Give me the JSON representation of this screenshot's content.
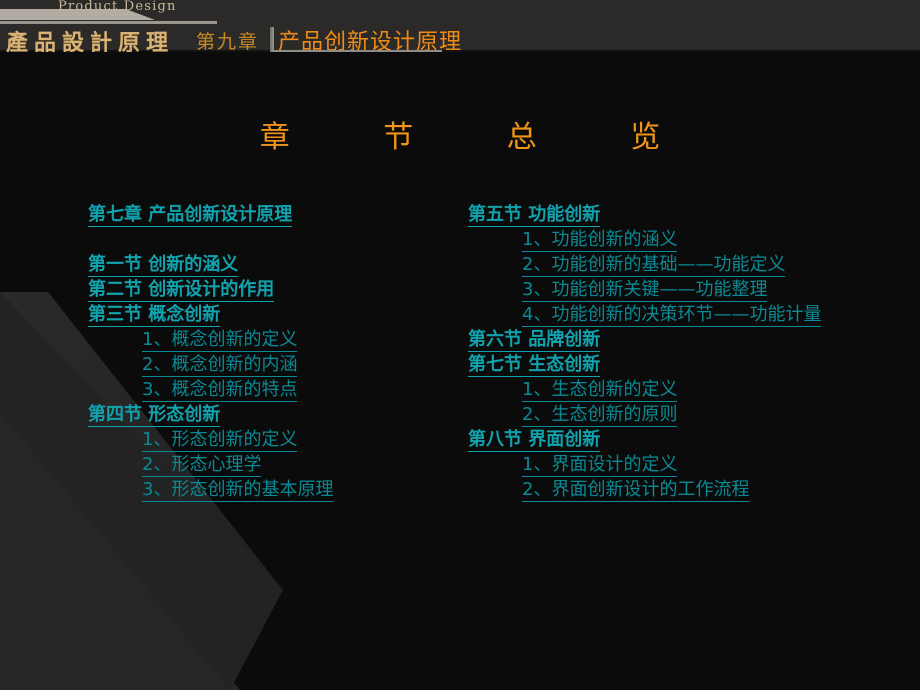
{
  "colors": {
    "background": "#0b0b0b",
    "decor_gray": "#262626",
    "header_bg": "#2b2a28",
    "gold": "#d9b276",
    "orange": "#f08c16",
    "orange_title": "#f0951a",
    "teal_bright": "#10a3ae",
    "teal_dim": "#0a8a94",
    "banner_gray": "#b3aca3"
  },
  "header": {
    "product_design": "Product Design",
    "course_title": "產品設計原理",
    "chapter_number": "第九章",
    "chapter_title": "产品创新设计原理"
  },
  "body": {
    "overview_heading": "章 节 总 览"
  },
  "toc": {
    "left_column": [
      {
        "level": "chapter",
        "text": "第七章  产品创新设计原理"
      },
      {
        "level": "spacer",
        "text": ""
      },
      {
        "level": 1,
        "text": "第一节  创新的涵义"
      },
      {
        "level": 1,
        "text": "第二节  创新设计的作用"
      },
      {
        "level": 1,
        "text": "第三节  概念创新"
      },
      {
        "level": 2,
        "text": "1、概念创新的定义"
      },
      {
        "level": 2,
        "text": "2、概念创新的内涵"
      },
      {
        "level": 2,
        "text": "3、概念创新的特点"
      },
      {
        "level": 1,
        "text": "第四节  形态创新"
      },
      {
        "level": 2,
        "text": "1、形态创新的定义"
      },
      {
        "level": 2,
        "text": "2、形态心理学"
      },
      {
        "level": 2,
        "text": "3、形态创新的基本原理"
      }
    ],
    "right_column": [
      {
        "level": 1,
        "text": "第五节 功能创新"
      },
      {
        "level": 2,
        "text": "1、功能创新的涵义"
      },
      {
        "level": 2,
        "text": "2、功能创新的基础——功能定义"
      },
      {
        "level": 2,
        "text": "3、功能创新关键——功能整理"
      },
      {
        "level": 2,
        "text": "4、功能创新的决策环节——功能计量"
      },
      {
        "level": 1,
        "text": "第六节 品牌创新"
      },
      {
        "level": 1,
        "text": "第七节 生态创新"
      },
      {
        "level": 2,
        "text": "1、生态创新的定义"
      },
      {
        "level": 2,
        "text": "2、生态创新的原则"
      },
      {
        "level": 1,
        "text": "第八节 界面创新"
      },
      {
        "level": 2,
        "text": "1、界面设计的定义"
      },
      {
        "level": 2,
        "text": "2、界面创新设计的工作流程"
      }
    ]
  }
}
